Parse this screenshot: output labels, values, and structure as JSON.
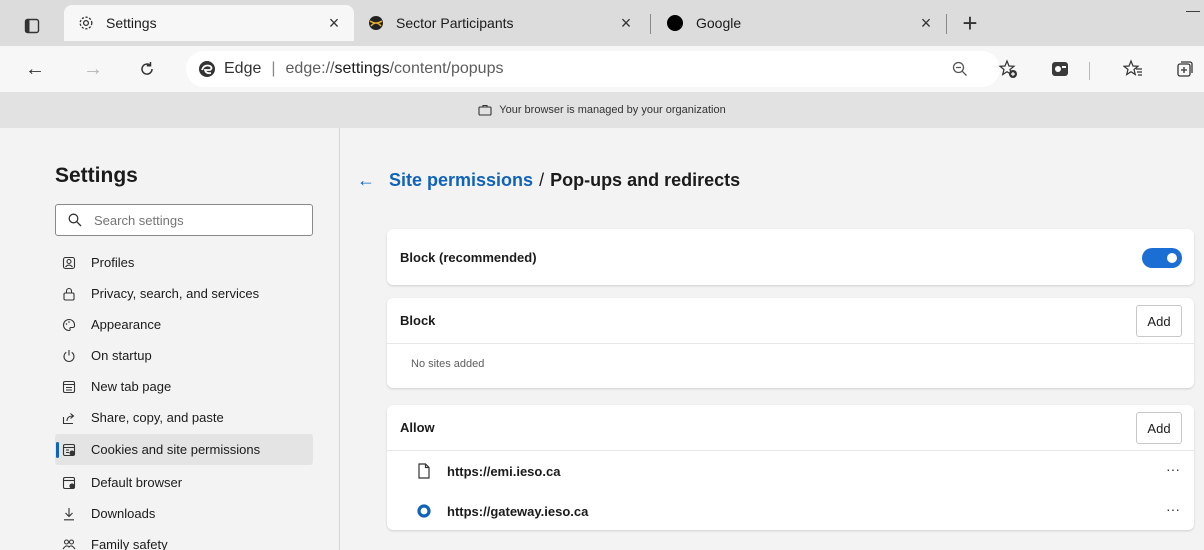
{
  "tabs": [
    {
      "title": "Settings",
      "icon": "gear-icon",
      "close": "×"
    },
    {
      "title": "Sector Participants",
      "icon": "globe-icon",
      "close": "×"
    },
    {
      "title": "Google",
      "icon": "circle-icon",
      "close": "×"
    }
  ],
  "newtab": "+",
  "toolbar": {
    "back": "←",
    "forward": "→",
    "refresh": "C",
    "edge_label": "Edge",
    "separator": "|",
    "url_prefix": "edge://",
    "url_bold": "settings",
    "url_rest": "/content/popups"
  },
  "banner": {
    "text": "Your browser is managed by your organization"
  },
  "sidebar": {
    "title": "Settings",
    "search_placeholder": "Search settings",
    "items": [
      {
        "label": "Profiles",
        "icon": "profile-icon"
      },
      {
        "label": "Privacy, search, and services",
        "icon": "lock-icon"
      },
      {
        "label": "Appearance",
        "icon": "palette-icon"
      },
      {
        "label": "On startup",
        "icon": "power-icon"
      },
      {
        "label": "New tab page",
        "icon": "newtab-icon"
      },
      {
        "label": "Share, copy, and paste",
        "icon": "share-icon"
      },
      {
        "label": "Cookies and site permissions",
        "icon": "cookies-icon"
      },
      {
        "label": "Default browser",
        "icon": "browser-icon"
      },
      {
        "label": "Downloads",
        "icon": "download-icon"
      },
      {
        "label": "Family safety",
        "icon": "family-icon"
      }
    ]
  },
  "main": {
    "breadcrumb_link": "Site permissions",
    "breadcrumb_sep": "/",
    "breadcrumb_current": "Pop-ups and redirects",
    "block_recommended": "Block (recommended)",
    "block_title": "Block",
    "block_add": "Add",
    "block_empty": "No sites added",
    "allow_title": "Allow",
    "allow_add": "Add",
    "allow_sites": [
      {
        "url": "https://emi.ieso.ca",
        "icon": "page-icon",
        "more": "···"
      },
      {
        "url": "https://gateway.ieso.ca",
        "icon": "site-ring-icon",
        "more": "···"
      }
    ]
  },
  "colors": {
    "accent": "#1063b8",
    "toggle": "#1a6ed4"
  }
}
